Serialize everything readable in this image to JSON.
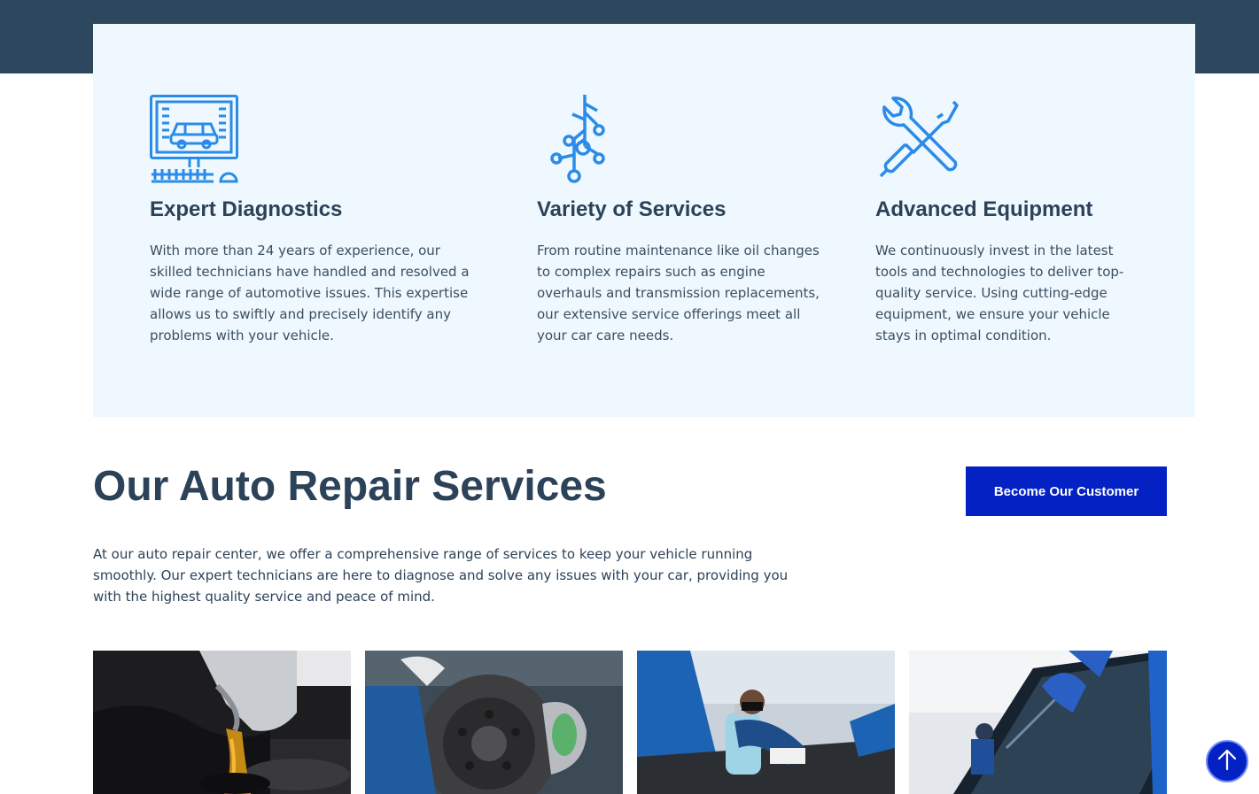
{
  "features": [
    {
      "icon": "computer-car-diagnostics-icon",
      "title": "Expert Diagnostics",
      "text": "With more than 24 years of experience, our skilled technicians have handled and resolved a wide range of automotive issues. This expertise allows us to swiftly and precisely identify any problems with your vehicle."
    },
    {
      "icon": "circuit-branches-icon",
      "title": "Variety of Services",
      "text": "From routine maintenance like oil changes to complex repairs such as engine overhauls and transmission replacements, our extensive service offerings meet all your car care needs."
    },
    {
      "icon": "wrench-screwdriver-icon",
      "title": "Advanced Equipment",
      "text": "We continuously invest in the latest tools and technologies to deliver top-quality service. Using cutting-edge equipment, we ensure your vehicle stays in optimal condition."
    }
  ],
  "services": {
    "title": "Our Auto Repair Services",
    "cta_label": "Become Our Customer",
    "intro": "At our auto repair center, we offer a comprehensive range of services to keep your vehicle running smoothly. Our expert technicians are here to diagnose and solve any issues with your car, providing you with the highest quality service and peace of mind."
  },
  "service_images": [
    "oil-change-photo",
    "brake-disc-photo",
    "ac-service-photo",
    "windshield-photo"
  ],
  "colors": {
    "accent": "#0422c4",
    "heading": "#2c4259",
    "panel": "#eef8fe",
    "band": "#2d475e",
    "icon": "#2b8be8"
  }
}
